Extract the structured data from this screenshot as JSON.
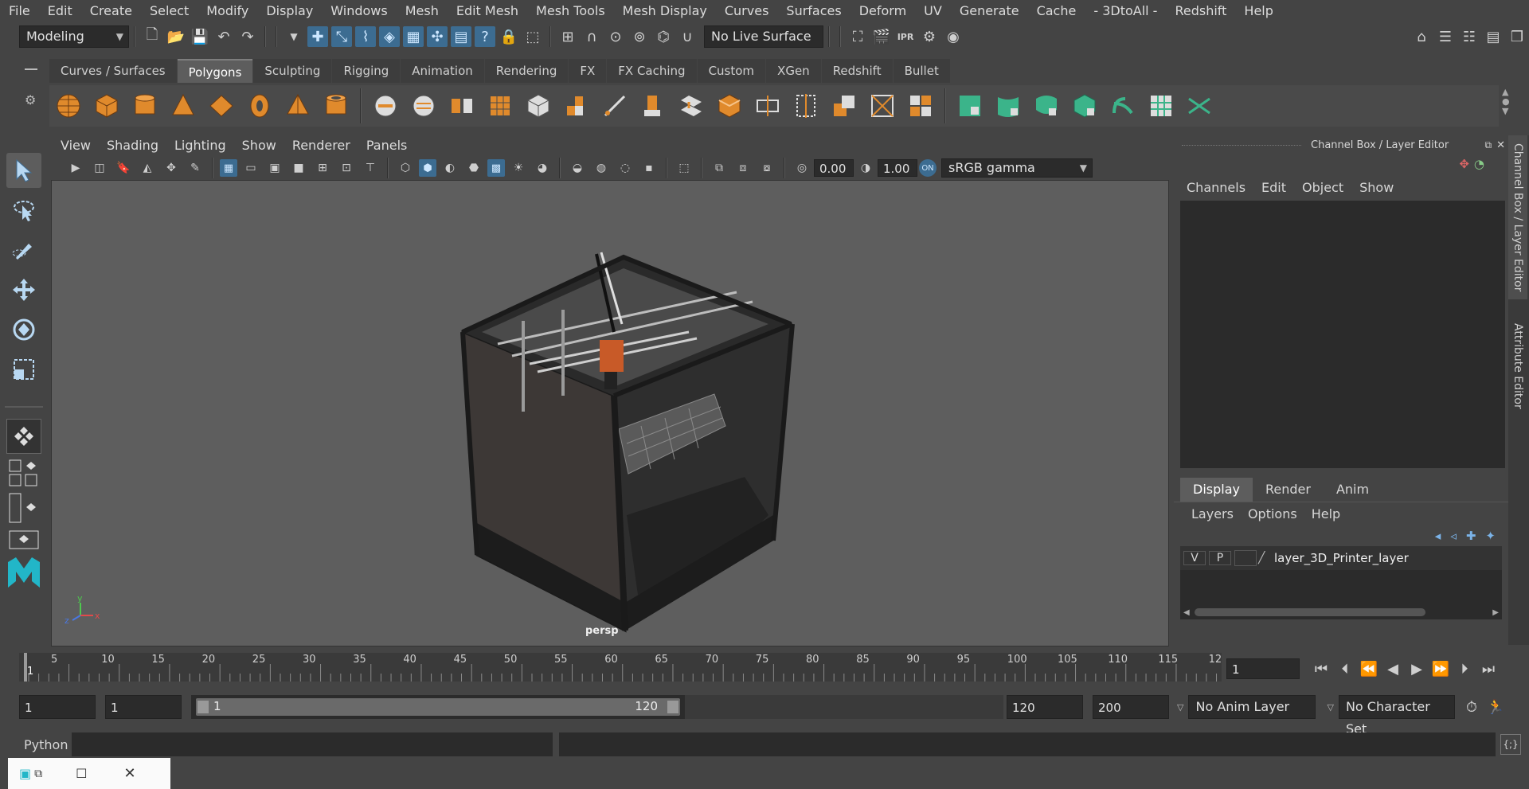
{
  "menubar": {
    "items": [
      "File",
      "Edit",
      "Create",
      "Select",
      "Modify",
      "Display",
      "Windows",
      "Mesh",
      "Edit Mesh",
      "Mesh Tools",
      "Mesh Display",
      "Curves",
      "Surfaces",
      "Deform",
      "UV",
      "Generate",
      "Cache",
      "- 3DtoAll -",
      "Redshift",
      "Help"
    ]
  },
  "statusline": {
    "mode_selector": "Modeling",
    "live_surface": "No Live Surface"
  },
  "shelf": {
    "tabs": [
      "Curves / Surfaces",
      "Polygons",
      "Sculpting",
      "Rigging",
      "Animation",
      "Rendering",
      "FX",
      "FX Caching",
      "Custom",
      "XGen",
      "Redshift",
      "Bullet"
    ],
    "active_tab": "Polygons"
  },
  "viewport": {
    "menu": [
      "View",
      "Shading",
      "Lighting",
      "Show",
      "Renderer",
      "Panels"
    ],
    "exposure": "0.00",
    "gamma": "1.00",
    "color_space": "sRGB gamma",
    "camera_label": "persp",
    "axis_labels": {
      "y": "y",
      "x": "x",
      "z": "z"
    },
    "colors": {
      "background": "#5e5e5e",
      "accent_orange": "#c85a28"
    }
  },
  "channel_box": {
    "title": "Channel Box / Layer Editor",
    "menu": [
      "Channels",
      "Edit",
      "Object",
      "Show"
    ]
  },
  "layer_editor": {
    "tabs": [
      "Display",
      "Render",
      "Anim"
    ],
    "active_tab": "Display",
    "menu": [
      "Layers",
      "Options",
      "Help"
    ],
    "layers": [
      {
        "visible": "V",
        "playback": "P",
        "name": "layer_3D_Printer_layer"
      }
    ]
  },
  "side_tabs": [
    "Channel Box / Layer Editor",
    "Attribute Editor"
  ],
  "timeline": {
    "ticks": [
      "5",
      "10",
      "15",
      "20",
      "25",
      "30",
      "35",
      "40",
      "45",
      "50",
      "55",
      "60",
      "65",
      "70",
      "75",
      "80",
      "85",
      "90",
      "95",
      "100",
      "105",
      "110",
      "115",
      "12"
    ],
    "start_marker": "1",
    "current_frame": "1"
  },
  "range": {
    "start": "1",
    "playback_start": "1",
    "slider_start": "1",
    "slider_end": "120",
    "playback_end": "120",
    "end": "200",
    "anim_layer": "No Anim Layer",
    "character_set": "No Character Set"
  },
  "cmdline": {
    "language": "Python"
  }
}
